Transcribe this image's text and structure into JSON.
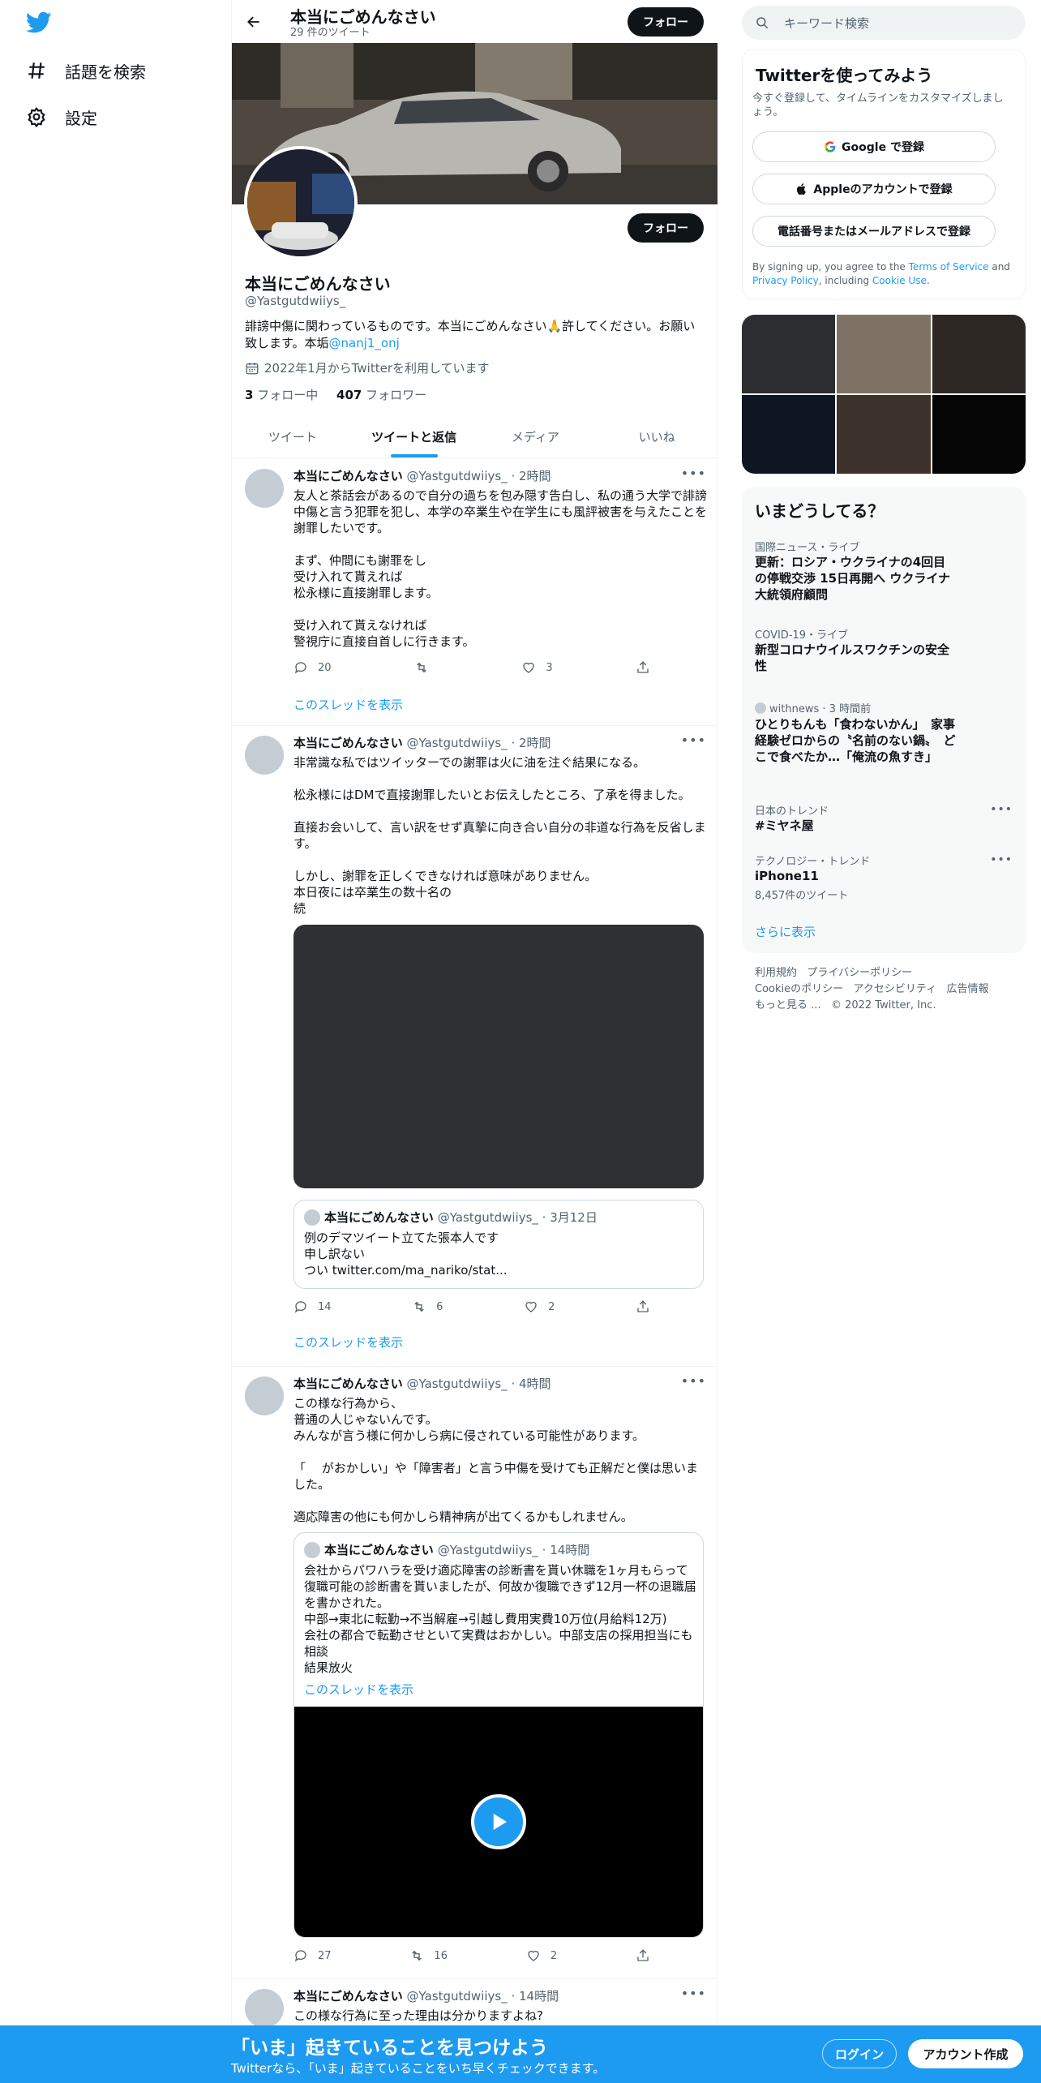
{
  "nav": {
    "explore_label": "話題を検索",
    "settings_label": "設定"
  },
  "header": {
    "title": "本当にごめんなさい",
    "tweet_count": "29 件のツイート",
    "follow_label": "フォロー"
  },
  "profile": {
    "name": "本当にごめんなさい",
    "handle": "@Yastgutdwiiys_",
    "bio_text": "誹謗中傷に関わっているものです。本当にごめんなさい🙏許してください。お願い致します。本垢",
    "bio_link": "@nanj1_onj",
    "joined": "2022年1月からTwitterを利用しています",
    "following_count": "3",
    "following_label": "フォロー中",
    "followers_count": "407",
    "followers_label": "フォロワー",
    "follow_label": "フォロー"
  },
  "tabs": [
    "ツイート",
    "ツイートと返信",
    "メディア",
    "いいね"
  ],
  "tweets": [
    {
      "name": "本当にごめんなさい",
      "meta": "@Yastgutdwiiys_ · 2時間",
      "text": "友人と茶話会があるので自分の過ちを包み隠す告白し、私の通う大学で誹謗中傷と言う犯罪を犯し、本学の卒業生や在学生にも風評被害を与えたことを謝罪したいです。\n\nまず、仲間にも謝罪をし\n受け入れて貰えれば\n松永様に直接謝罪します。\n\n受け入れて貰えなければ\n警視庁に直接自首しに行きます。",
      "replies": "20",
      "retweets": "",
      "likes": "3",
      "thread": "このスレッドを表示"
    },
    {
      "name": "本当にごめんなさい",
      "meta": "@Yastgutdwiiys_ · 2時間",
      "text": "非常識な私ではツイッターでの謝罪は火に油を注ぐ結果になる。\n\n松永様にはDMで直接謝罪したいとお伝えしたところ、了承を得ました。\n\n直接お会いして、言い訳をせず真摯に向き合い自分の非道な行為を反省します。\n\nしかし、謝罪を正しくできなければ意味がありません。\n本日夜には卒業生の数十名の\n続",
      "quote_name": "本当にごめんなさい",
      "quote_meta": "@Yastgutdwiiys_ · 3月12日",
      "quote_text": "例のデマツイート立てた張本人です\n申し訳ない\nつい twitter.com/ma_nariko/stat...",
      "replies": "14",
      "retweets": "6",
      "likes": "2",
      "thread": "このスレッドを表示"
    },
    {
      "name": "本当にごめんなさい",
      "meta": "@Yastgutdwiiys_ · 4時間",
      "text": "この様な行為から、\n普通の人じゃないんです。\nみんなが言う様に何かしら病に侵されている可能性があります。\n\n「　 がおかしい」や「障害者」と言う中傷を受けても正解だと僕は思いました。\n\n適応障害の他にも何かしら精神病が出てくるかもしれません。",
      "quote_name": "本当にごめんなさい",
      "quote_meta": "@Yastgutdwiiys_ · 14時間",
      "quote_text": "会社からパワハラを受け適応障害の診断書を貰い休職を1ヶ月もらって復職可能の診断書を貰いましたが、何故か復職できず12月一杯の退職届を書かされた。\n中部→東北に転勤→不当解雇→引越し費用実費10万位(月給料12万)\n会社の都合で転勤させといて実費はおかしい。中部支店の採用担当にも相談\n結果放火",
      "quote_thread": "このスレッドを表示",
      "replies": "27",
      "retweets": "16",
      "likes": "2"
    },
    {
      "name": "本当にごめんなさい",
      "meta": "@Yastgutdwiiys_ · 14時間",
      "text": "この様な行為に至った理由は分かりますよね?"
    }
  ],
  "right": {
    "search_placeholder": "キーワード検索",
    "signup": {
      "title": "Twitterを使ってみよう",
      "subtitle": "今すぐ登録して、タイムラインをカスタマイズしましょう。",
      "google": "Google で登録",
      "apple": "Appleのアカウントで登録",
      "phone": "電話番号またはメールアドレスで登録",
      "legal_1": "By signing up, you agree to the ",
      "tos": "Terms of Service",
      "legal_2": " and ",
      "privacy": "Privacy Policy",
      "legal_3": ", including ",
      "cookie": "Cookie Use",
      "legal_4": "."
    },
    "trends": {
      "title": "いまどうしてる？",
      "items": [
        {
          "meta": "国際ニュース・ライブ",
          "title": "更新：ロシア・ウクライナの4回目の停戦交渉 15日再開へ ウクライナ大統領府顧問"
        },
        {
          "meta": "COVID-19・ライブ",
          "title": "新型コロナウイルスワクチンの安全性"
        },
        {
          "meta": "withnews · 3 時間前",
          "title": "ひとりもんも「食わないかん」　家事経験ゼロからの〝名前のない鍋〟　どこで食べたか…「俺流の魚すき」"
        },
        {
          "meta": "日本のトレンド",
          "title": "#ミヤネ屋"
        },
        {
          "meta": "テクノロジー・トレンド",
          "title": "iPhone11",
          "count": "8,457件のツイート"
        }
      ],
      "show_more": "さらに表示"
    },
    "footer": {
      "links": [
        "利用規約",
        "プライバシーポリシー",
        "Cookieのポリシー",
        "アクセシビリティ",
        "広告情報",
        "もっと見る ..."
      ],
      "copyright": "© 2022 Twitter, Inc."
    }
  },
  "bottom": {
    "title": "「いま」起きていることを見つけよう",
    "subtitle": "Twitterなら、「いま」起きていることをいち早くチェックできます。",
    "login": "ログイン",
    "signup": "アカウント作成"
  },
  "colors": {
    "accent": "#1d9bf0",
    "text": "#0f1419",
    "muted": "#536471"
  }
}
